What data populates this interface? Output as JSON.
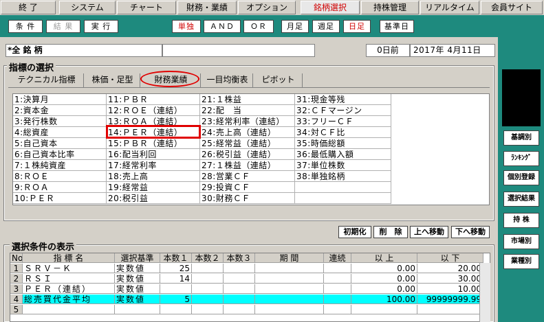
{
  "menu": [
    "終 了",
    "システム",
    "チャート",
    "財務・業績",
    "オプション",
    "銘柄選択",
    "持株管理",
    "リアルタイム",
    "会員サイト"
  ],
  "toolbar": {
    "joken": "条 件",
    "kekka": "結 果",
    "jikko": "実 行",
    "tandoku": "単独",
    "and": "ＡＮＤ",
    "or": "ＯＲ",
    "getsuashi": "月足",
    "shuashi": "週足",
    "hiashi": "日足",
    "kijunbi": "基準日"
  },
  "header": {
    "code": "*全 銘 柄",
    "blank": "",
    "days": "0日前",
    "date": "2017年 4月11日"
  },
  "section1": {
    "title": "指標の選択"
  },
  "tabs": [
    "テクニカル指標",
    "株価・足型",
    "財務業績",
    "一目均衡表",
    "ピボット"
  ],
  "indicators": [
    [
      "1:決算月",
      "11:ＰＢＲ",
      "21:１株益",
      "31:現金等残"
    ],
    [
      "2:資本金",
      "12:ＲＯＥ（連結）",
      "22:配　当",
      "32:ＣＦマージン"
    ],
    [
      "3:発行株数",
      "13:ＲＯＡ（連結）",
      "23:経常利率（連結）",
      "33:フリーＣＦ"
    ],
    [
      "4:総資産",
      "14:ＰＥＲ（連結）",
      "24:売上高（連結）",
      "34:対ＣＦ比"
    ],
    [
      "5:自己資本",
      "15:ＰＢＲ（連結）",
      "25:経常益（連結）",
      "35:時価総額"
    ],
    [
      "6:自己資本比率",
      "16:配当利回",
      "26:税引益（連結）",
      "36:最低購入額"
    ],
    [
      "7:１株純資産",
      "17:経常利率",
      "27:１株益（連結）",
      "37:単位株数"
    ],
    [
      "8:ＲＯＥ",
      "18:売上高",
      "28:営業ＣＦ",
      "38:単独銘柄"
    ],
    [
      "9:ＲＯＡ",
      "19:経常益",
      "29:投資ＣＦ",
      ""
    ],
    [
      "10:ＰＥＲ",
      "20:税引益",
      "30:財務ＣＦ",
      ""
    ]
  ],
  "buttons": {
    "init": "初期化",
    "delete": "削　除",
    "up": "上へ移動",
    "down": "下へ移動"
  },
  "section2": {
    "title": "選択条件の表示"
  },
  "table": {
    "headers": [
      "No",
      "指 標 名",
      "選択基準",
      "本数１",
      "本数２",
      "本数３",
      "期 間",
      "連続",
      "以 上",
      "以 下"
    ],
    "rows": [
      [
        "1",
        "ＳＲＶ－Ｋ",
        "実数値",
        "25",
        "",
        "",
        "",
        "",
        "0.00",
        "20.00"
      ],
      [
        "2",
        "ＲＳＩ",
        "実数値",
        "14",
        "",
        "",
        "",
        "",
        "0.00",
        "30.00"
      ],
      [
        "3",
        "ＰＥＲ（連結）",
        "実数値",
        "",
        "",
        "",
        "",
        "",
        "0.00",
        "10.00"
      ],
      [
        "4",
        "総売買代金平均",
        "実数値",
        "5",
        "",
        "",
        "",
        "",
        "100.00",
        "99999999.99"
      ],
      [
        "5",
        "",
        "",
        "",
        "",
        "",
        "",
        "",
        "",
        ""
      ]
    ]
  },
  "rightpanel": [
    "基調別",
    "ﾗﾝｷﾝｸﾞ",
    "個別登録",
    "選択結果",
    "持 株",
    "市場別",
    "業種別"
  ],
  "colors": {
    "teal": "#1e8a7e",
    "highlight": "#00ffff",
    "red": "#e00000"
  }
}
